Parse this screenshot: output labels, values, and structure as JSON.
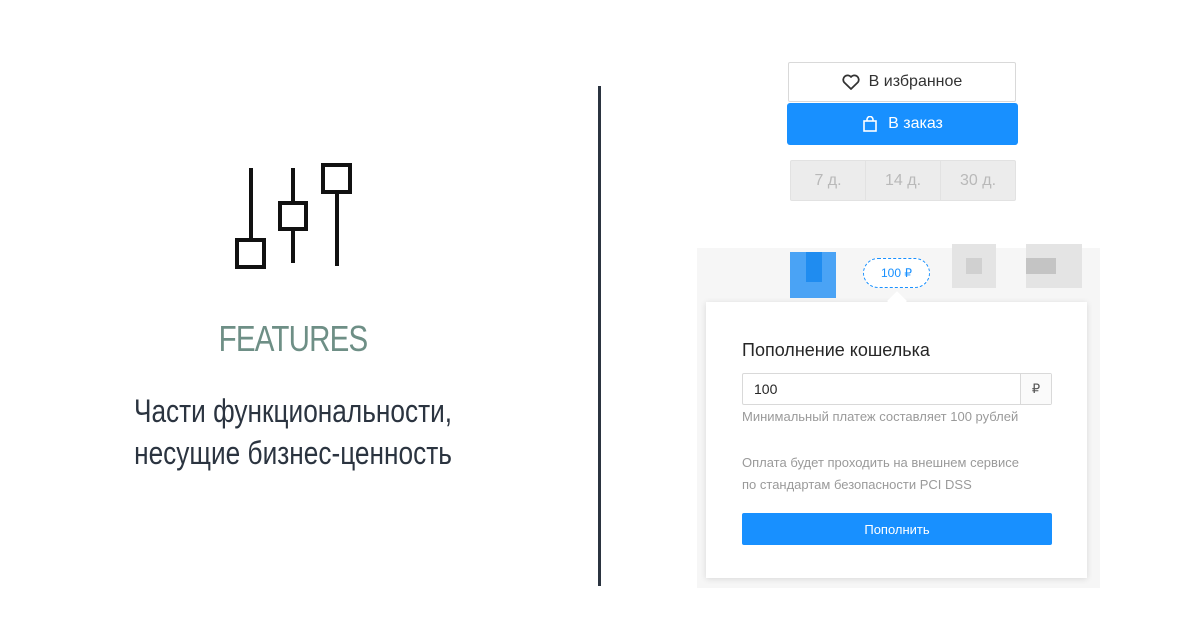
{
  "features": {
    "title": "FEATURES",
    "description_line1": "Части функциональности,",
    "description_line2": "несущие бизнес-ценность",
    "icon": "sliders-icon",
    "title_color": "#6e8f86"
  },
  "actions": {
    "favorite_label": "В избранное",
    "favorite_icon": "heart-icon",
    "order_label": "В заказ",
    "order_icon": "shopping-bag-icon",
    "accent_color": "#1890ff"
  },
  "periods": [
    "7 д.",
    "14 д.",
    "30 д."
  ],
  "price_chip": "100 ₽",
  "wallet": {
    "title": "Пополнение кошелька",
    "amount_value": "100",
    "currency": "₽",
    "min_hint": "Минимальный платеж составляет 100 рублей",
    "pci_note_line1": "Оплата будет проходить на внешнем сервисе",
    "pci_note_line2": "по стандартам безопасности PCI DSS",
    "submit_label": "Пополнить"
  }
}
